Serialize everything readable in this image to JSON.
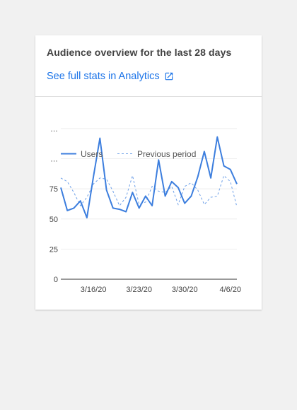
{
  "card": {
    "title": "Audience overview for the last 28 days",
    "link_label": "See full stats in Analytics",
    "link_icon": "external-link-icon"
  },
  "colors": {
    "link": "#1a73e8",
    "users": "#3c7ede",
    "previous": "#6ea0e8"
  },
  "chart_data": {
    "type": "line",
    "title": "",
    "xlabel": "",
    "ylabel": "",
    "ylim": [
      0,
      100
    ],
    "y_ticks": [
      {
        "value": 0,
        "label": "0"
      },
      {
        "value": 25,
        "label": "25"
      },
      {
        "value": 50,
        "label": "50"
      },
      {
        "value": 75,
        "label": "75"
      },
      {
        "value": 100,
        "label": "…"
      },
      {
        "value": 125,
        "label": "…"
      }
    ],
    "x_ticks": [
      {
        "index": 5,
        "label": "3/16/20"
      },
      {
        "index": 12,
        "label": "3/23/20"
      },
      {
        "index": 19,
        "label": "3/30/20"
      },
      {
        "index": 26,
        "label": "4/6/20"
      }
    ],
    "grid": true,
    "legend": "top-left",
    "series": [
      {
        "name": "Users",
        "style": "solid",
        "values": [
          76,
          57,
          59,
          65,
          51,
          85,
          117,
          74,
          59,
          58,
          56,
          72,
          59,
          69,
          61,
          99,
          69,
          81,
          76,
          63,
          69,
          85,
          106,
          84,
          118,
          94,
          91,
          79
        ]
      },
      {
        "name": "Previous period",
        "style": "dashed",
        "values": [
          84,
          81,
          72,
          61,
          68,
          79,
          84,
          83,
          73,
          61,
          68,
          86,
          62,
          64,
          77,
          73,
          72,
          77,
          62,
          77,
          80,
          74,
          62,
          68,
          69,
          86,
          81,
          60
        ]
      }
    ]
  }
}
